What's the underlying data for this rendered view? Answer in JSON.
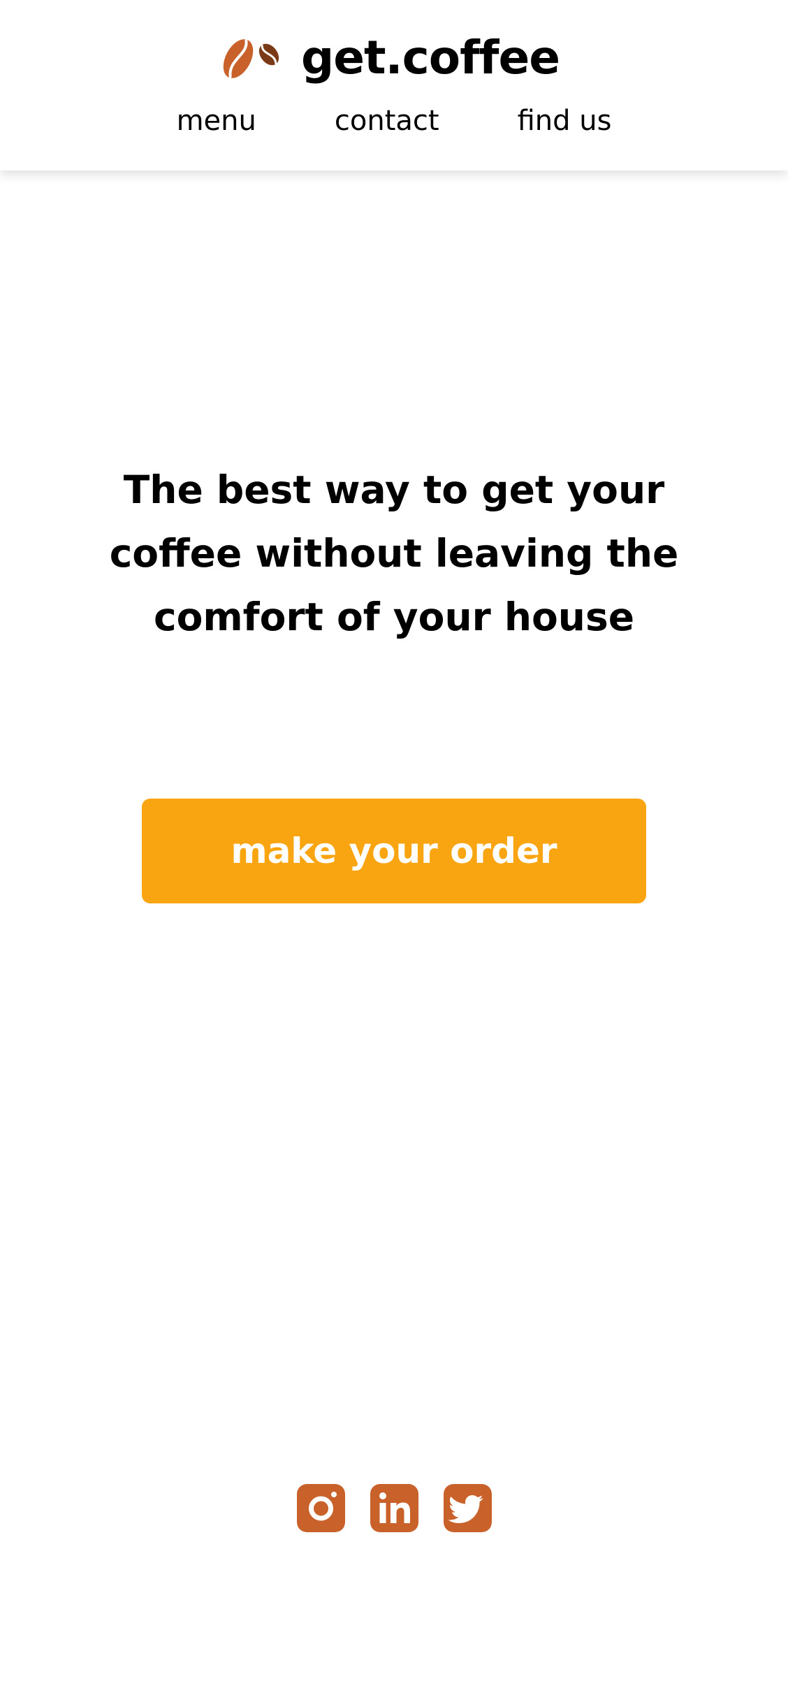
{
  "header": {
    "brand_name": "get.coffee",
    "logo_icon": "coffee-beans-icon",
    "nav": [
      {
        "label": "menu"
      },
      {
        "label": "contact"
      },
      {
        "label": "find us"
      }
    ]
  },
  "hero": {
    "headline": "The best way to get your coffee without leaving the comfort of your house",
    "cta_label": "make your order"
  },
  "footer": {
    "social_icons": [
      "instagram-icon",
      "linkedin-icon",
      "twitter-icon"
    ]
  },
  "colors": {
    "accent": "#F9A512",
    "brand_brown": "#C8612A",
    "dark_brown": "#7A3A15",
    "background": "#FFFFFF",
    "text": "#000000"
  }
}
